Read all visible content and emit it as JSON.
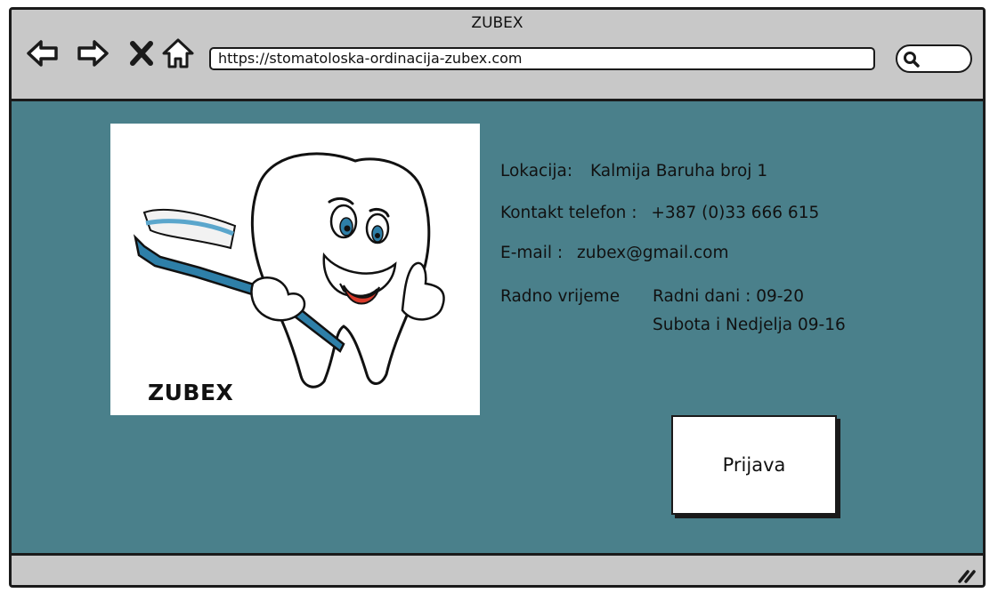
{
  "window": {
    "title": "ZUBEX"
  },
  "browser": {
    "url": "https://stomatoloska-ordinacija-zubex.com",
    "icons": [
      "back-arrow-icon",
      "forward-arrow-icon",
      "close-icon",
      "home-icon",
      "search-icon",
      "resize-grip-icon"
    ]
  },
  "image": {
    "caption": "ZUBEX"
  },
  "info": {
    "location_label": "Lokacija:",
    "location_value": "Kalmija Baruha broj 1",
    "phone_label": "Kontakt telefon :",
    "phone_value": "+387 (0)33 666 615",
    "email_label": "E-mail :",
    "email_value": "zubex@gmail.com",
    "hours_label": "Radno vrijeme",
    "hours_weekdays": "Radni dani : 09-20",
    "hours_weekend": "Subota i Nedjelja 09-16"
  },
  "login_button": {
    "label": "Prijava"
  },
  "colors": {
    "content_bg": "#4a808b",
    "chrome_bg": "#c8c8c8",
    "toothbrush": "#2e7fa8",
    "tongue": "#d93a2b"
  }
}
